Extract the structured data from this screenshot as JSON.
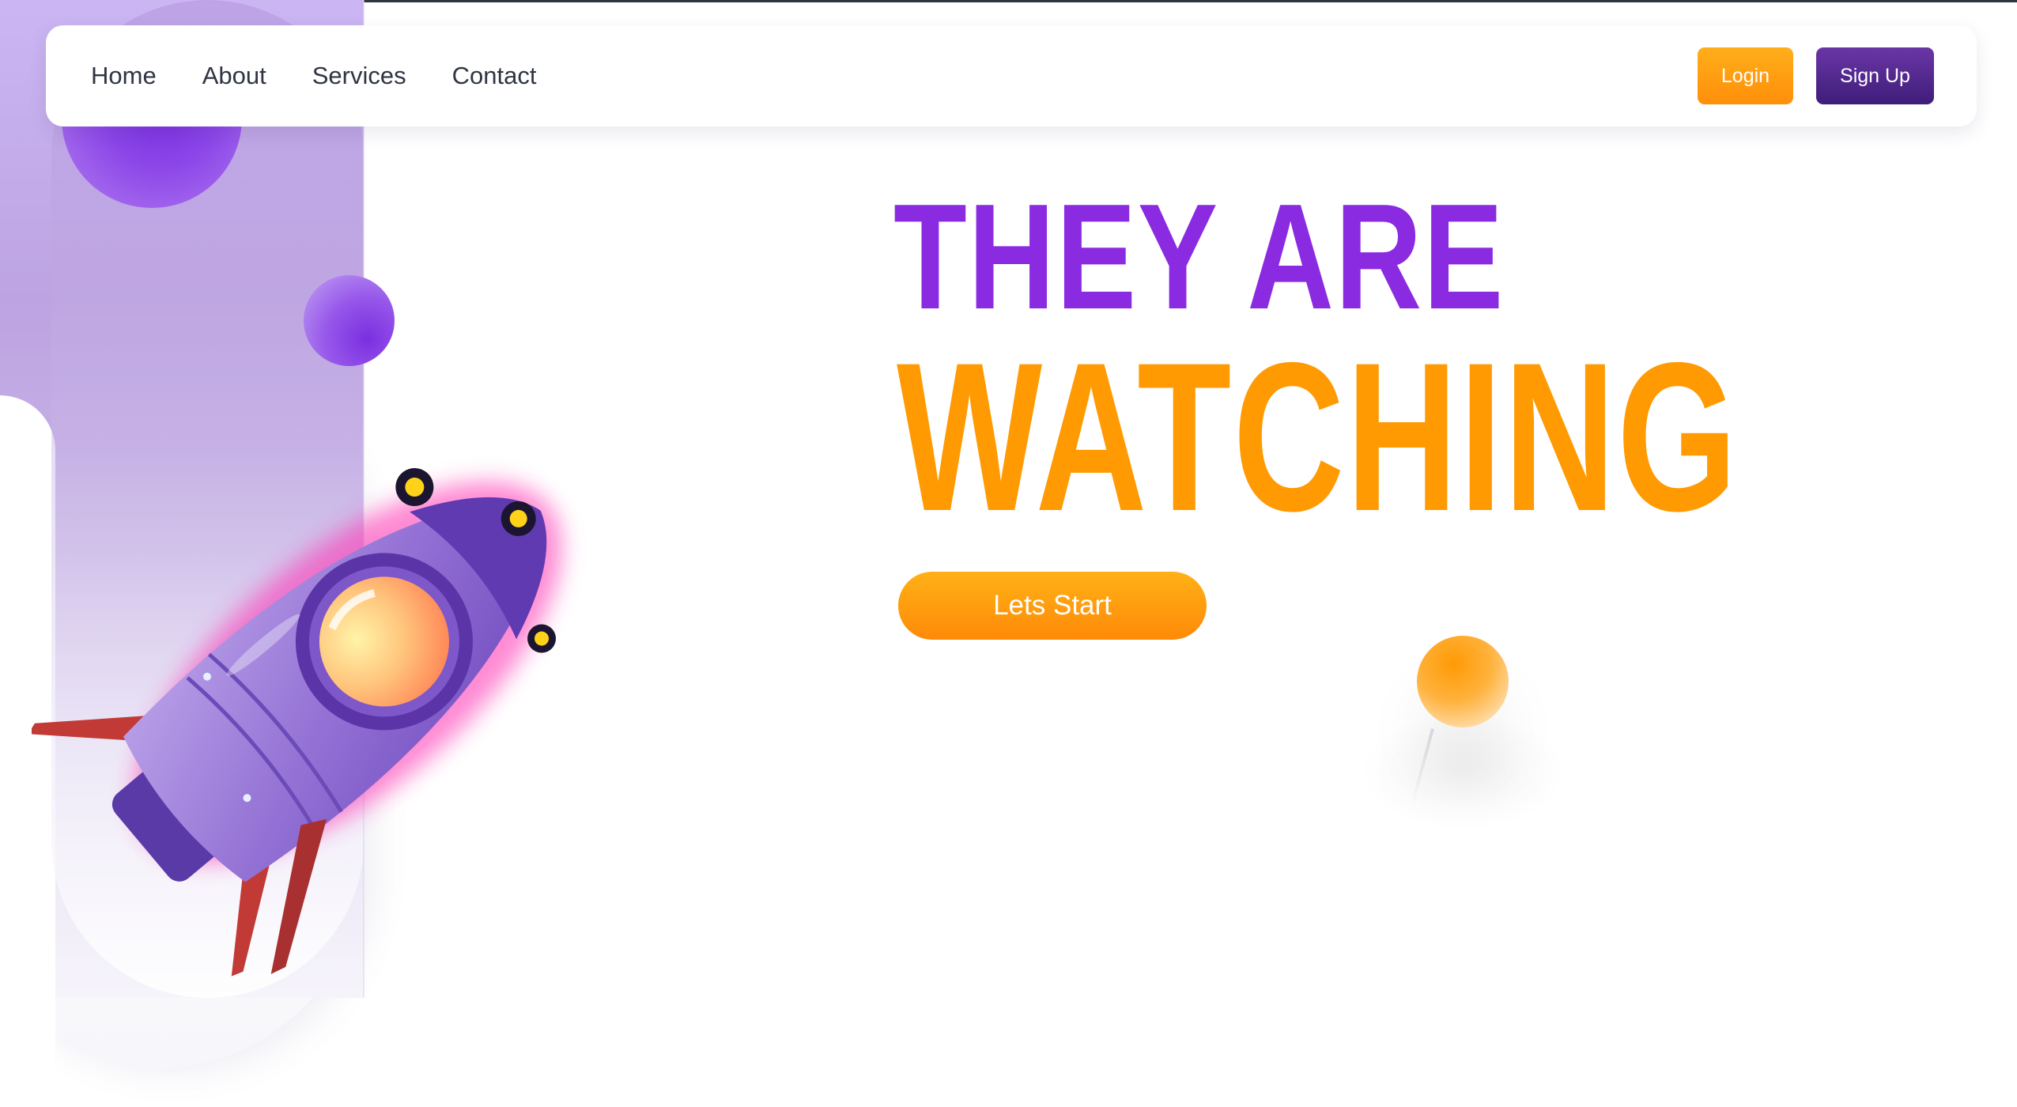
{
  "nav": {
    "links": [
      {
        "label": "Home"
      },
      {
        "label": "About"
      },
      {
        "label": "Services"
      },
      {
        "label": "Contact"
      }
    ],
    "login_label": "Login",
    "signup_label": "Sign Up"
  },
  "hero": {
    "line1": "THEY ARE",
    "line2": "WATCHING",
    "cta_label": "Lets Start"
  },
  "colors": {
    "purple": "#8a2be2",
    "orange": "#ff9a02",
    "signup_bg": "#4a2384",
    "login_bg": "#ff9e10"
  },
  "icons": [
    "rocket-illustration"
  ]
}
